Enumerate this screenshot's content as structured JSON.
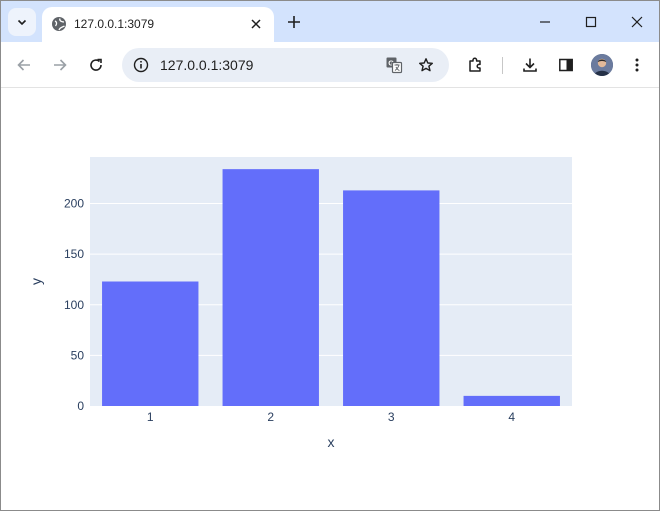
{
  "browser": {
    "tab": {
      "title": "127.0.0.1:3079",
      "favicon": "globe-icon"
    },
    "address_bar": {
      "url": "127.0.0.1:3079"
    }
  },
  "colors": {
    "bar": "#636efa",
    "plot_bg": "#e5ecf6",
    "tabstrip": "#d3e3fd"
  },
  "chart_data": {
    "type": "bar",
    "categories": [
      "1",
      "2",
      "3",
      "4"
    ],
    "values": [
      123,
      234,
      213,
      10
    ],
    "xlabel": "x",
    "ylabel": "y",
    "ylim": [
      0,
      246
    ],
    "yticks": [
      0,
      50,
      100,
      150,
      200
    ],
    "grid": true
  }
}
